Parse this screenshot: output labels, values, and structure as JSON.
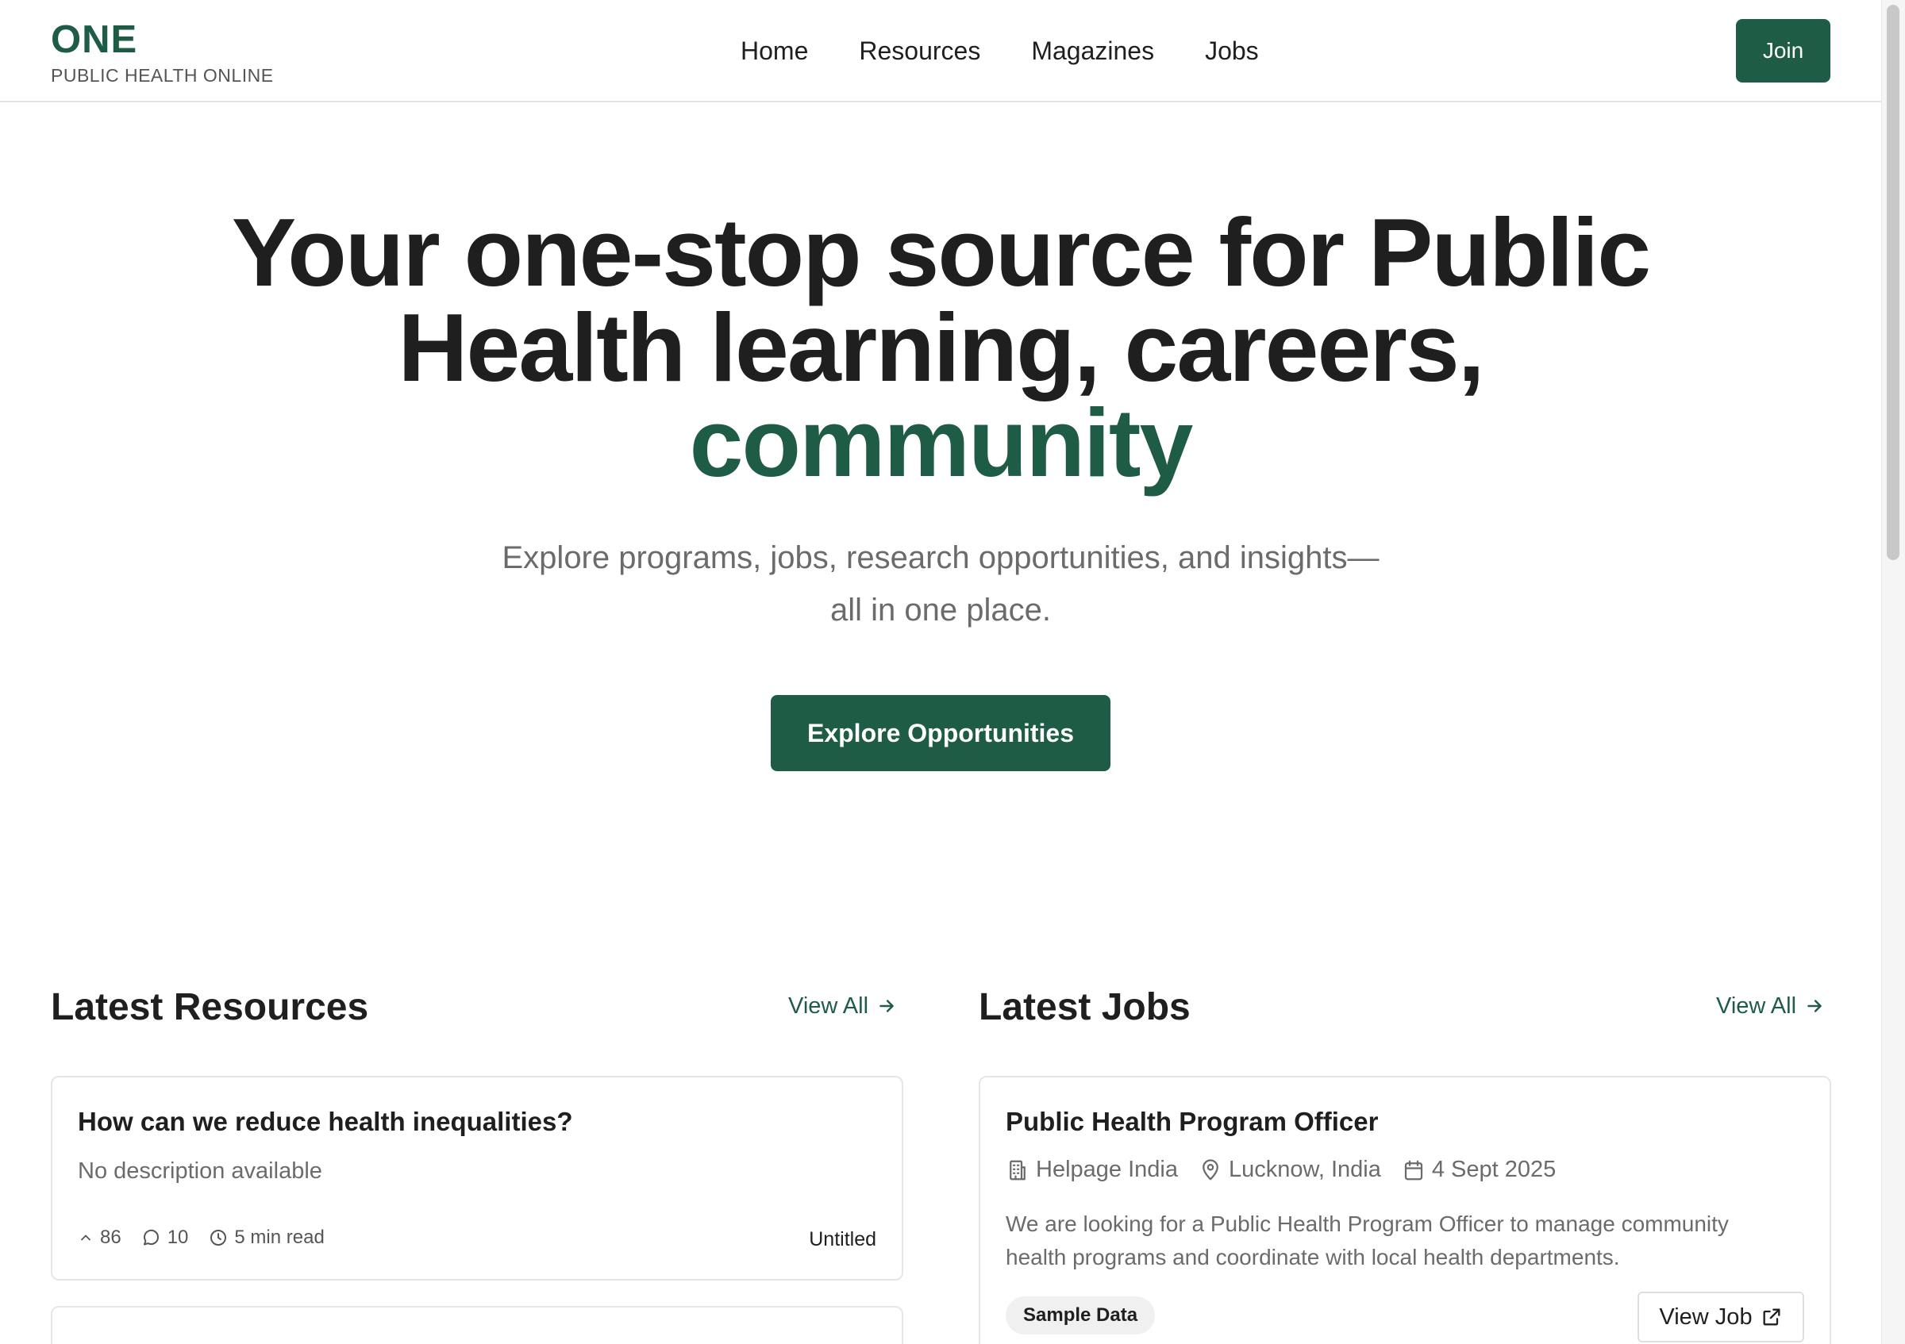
{
  "brand": {
    "name": "ONE",
    "tagline": "PUBLIC HEALTH ONLINE",
    "accent_color": "#1f5c46"
  },
  "nav": {
    "items": [
      {
        "label": "Home"
      },
      {
        "label": "Resources"
      },
      {
        "label": "Magazines"
      },
      {
        "label": "Jobs"
      }
    ],
    "join_label": "Join"
  },
  "hero": {
    "title_line1": "Your one-stop source for Public",
    "title_line2": "Health learning, careers,",
    "title_accent": "community",
    "subtitle_line1": "Explore programs, jobs, research opportunities, and insights—",
    "subtitle_line2": "all in one place.",
    "cta_label": "Explore Opportunities"
  },
  "resources": {
    "title": "Latest Resources",
    "view_all": "View All",
    "items": [
      {
        "title": "How can we reduce health inequalities?",
        "description": "No description available",
        "upvotes": "86",
        "comments": "10",
        "read_time": "5 min read",
        "tag": "Untitled"
      }
    ]
  },
  "jobs": {
    "title": "Latest Jobs",
    "view_all": "View All",
    "items": [
      {
        "title": "Public Health Program Officer",
        "organization": "Helpage India",
        "location": "Lucknow, India",
        "date": "4 Sept 2025",
        "description": "We are looking for a Public Health Program Officer to manage community health programs and coordinate with local health departments.",
        "badge": "Sample Data",
        "button": "View Job"
      }
    ]
  }
}
